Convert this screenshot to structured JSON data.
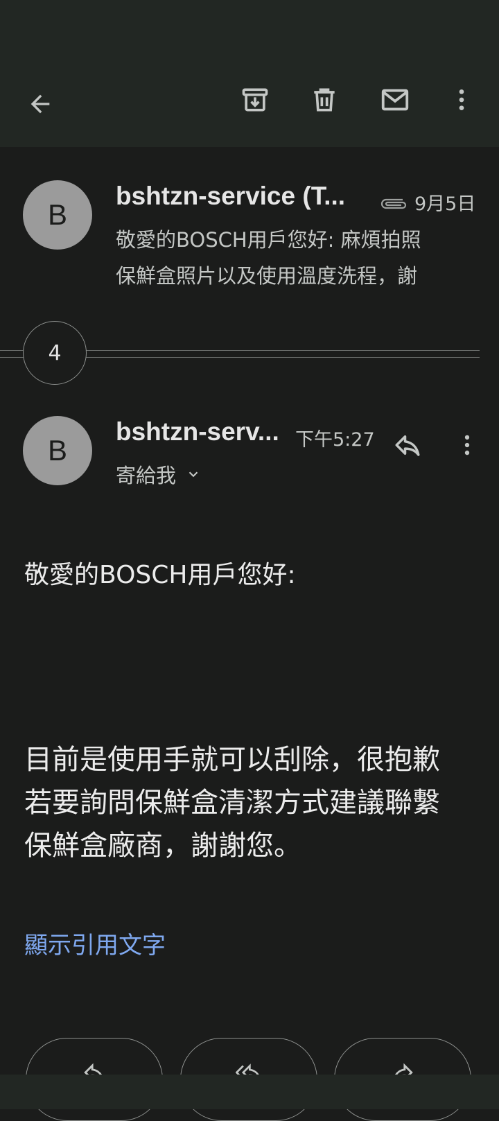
{
  "toolbar": {
    "back_icon": "arrow-left-icon",
    "archive_icon": "archive-icon",
    "delete_icon": "trash-icon",
    "unread_icon": "mail-icon",
    "more_icon": "more-vertical-icon"
  },
  "thread": {
    "first_message": {
      "avatar_letter": "B",
      "sender": "bshtzn-service (T...",
      "has_attachment": true,
      "date": "9月5日",
      "snippet_line1": "敬愛的BOSCH用戶您好: 麻煩拍照",
      "snippet_line2": "保鮮盒照片以及使用溫度洗程，謝"
    },
    "collapsed_count": "4",
    "latest_message": {
      "avatar_letter": "B",
      "sender": "bshtzn-serv...",
      "time": "下午5:27",
      "recipient": "寄給我",
      "greeting": "敬愛的BOSCH用戶您好:",
      "body_line1": "目前是使用手就可以刮除，很抱歉",
      "body_line2": "若要詢問保鮮盒清潔方式建議聯繫",
      "body_line3": "保鮮盒廠商，謝謝您。",
      "show_quoted": "顯示引用文字"
    }
  },
  "colors": {
    "background": "#1b1c1b",
    "toolbar": "#222723",
    "link": "#7fa8ef",
    "avatar": "#9b9b9b"
  }
}
